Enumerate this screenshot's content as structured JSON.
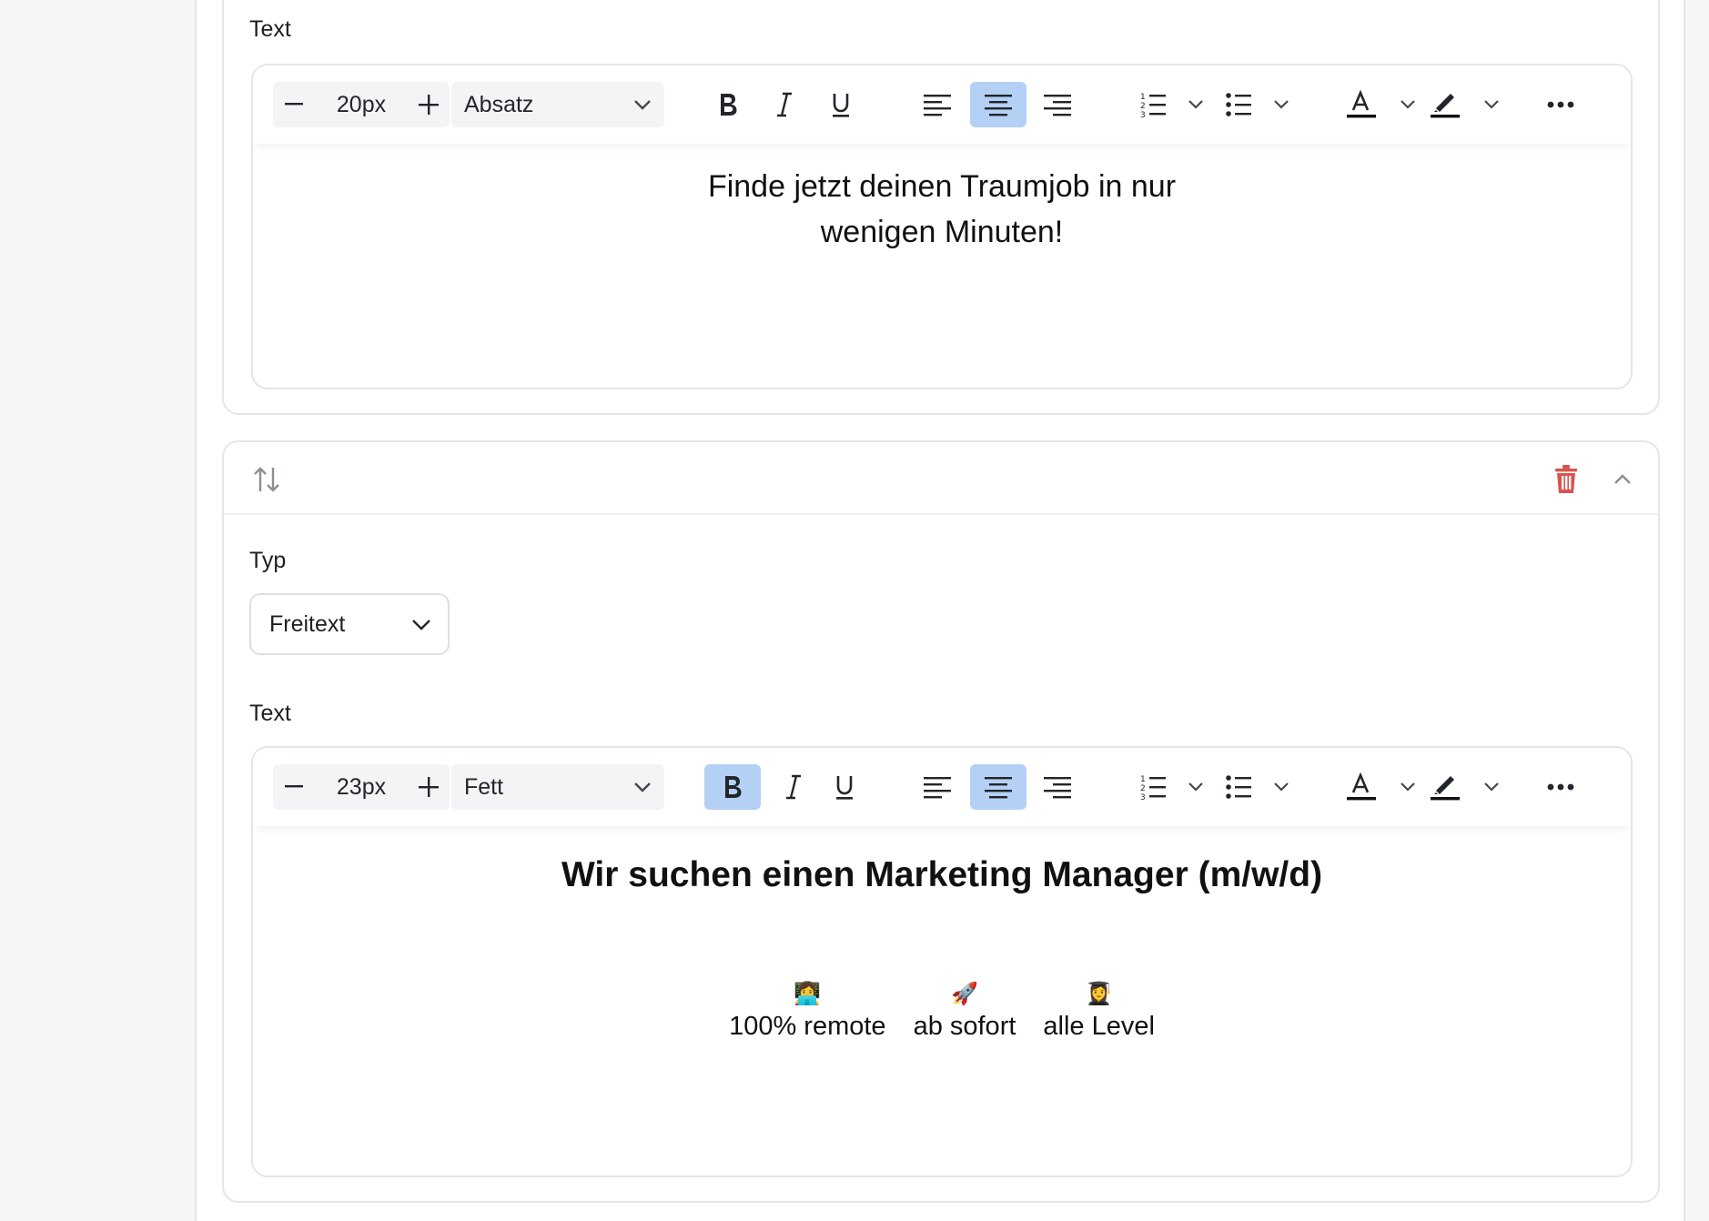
{
  "card1": {
    "text_label": "Text",
    "toolbar": {
      "font_size": "20px",
      "block_type": "Absatz",
      "bold_active": false
    },
    "content_lines": [
      "Finde jetzt deinen Traumjob in nur",
      "wenigen Minuten!"
    ]
  },
  "card2": {
    "type_label": "Typ",
    "type_value": "Freitext",
    "text_label": "Text",
    "toolbar": {
      "font_size": "23px",
      "block_type": "Fett",
      "bold_active": true
    },
    "heading": "Wir suchen einen Marketing Manager (m/w/d)",
    "features": [
      {
        "emoji": "👩‍💻",
        "text": "100% remote"
      },
      {
        "emoji": "🚀",
        "text": "ab sofort"
      },
      {
        "emoji": "👩‍🎓",
        "text": "alle Level"
      }
    ]
  },
  "colors": {
    "active_button": "#b4d0f5",
    "trash": "#d9534f",
    "icon_gray": "#8a8f98"
  }
}
